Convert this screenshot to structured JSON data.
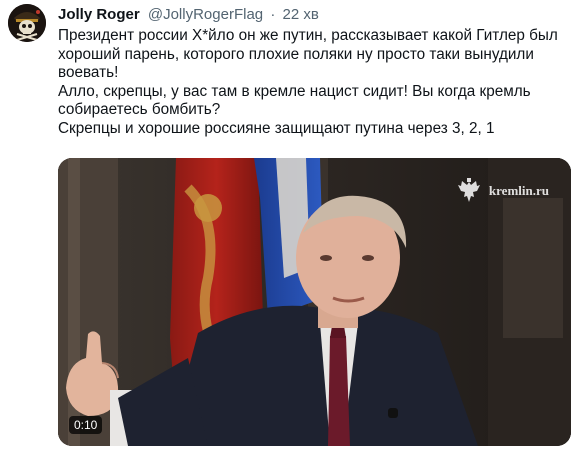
{
  "author": {
    "display_name": "Jolly Roger",
    "handle": "@JollyRogerFlag",
    "separator": "·",
    "time": "22 хв",
    "avatar_icon": "skull-pirate-avatar"
  },
  "tweet": {
    "lines": [
      "Президент россии Х*йло он же путин, рассказывает какой Гитлер был хороший парень, которого плохие поляки ну просто таки вынудили воевать!",
      "Алло, скрепцы, у вас там в кремле нацист сидит! Вы когда кремль собираетесь бомбить?",
      "Скрепцы и хорошие россияне защищают путина через 3, 2, 1"
    ]
  },
  "media": {
    "type": "video",
    "duration": "0:10",
    "watermark_text": "kremlin.ru",
    "watermark_icon": "double-headed-eagle-icon"
  }
}
